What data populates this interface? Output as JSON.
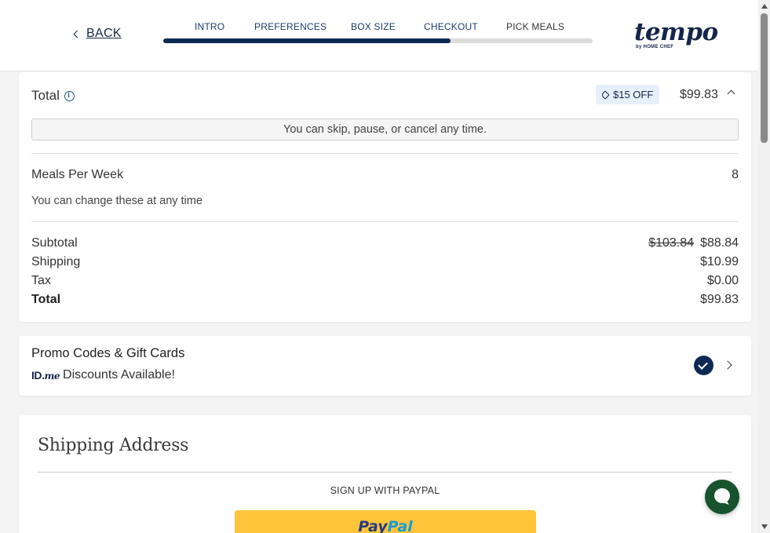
{
  "header": {
    "back_label": "BACK",
    "steps": [
      "INTRO",
      "PREFERENCES",
      "BOX SIZE",
      "CHECKOUT",
      "PICK MEALS"
    ],
    "progress": 0.67,
    "logo": {
      "word": "tempo",
      "tagline": "by HOME CHEF"
    }
  },
  "summary": {
    "total_label": "Total",
    "discount_badge": "$15 OFF",
    "total_amount": "$99.83",
    "skip_note": "You can skip, pause, or cancel any time.",
    "meals_label": "Meals Per Week",
    "meals_value": "8",
    "change_note": "You can change these at any time",
    "subtotal_label": "Subtotal",
    "subtotal_original": "$103.84",
    "subtotal_value": "$88.84",
    "shipping_label": "Shipping",
    "shipping_value": "$10.99",
    "tax_label": "Tax",
    "tax_value": "$0.00",
    "grand_total_label": "Total",
    "grand_total_value": "$99.83"
  },
  "promo": {
    "title": "Promo Codes & Gift Cards",
    "idme_logo_a": "ID",
    "idme_logo_b": ".me",
    "idme_text": "Discounts Available!"
  },
  "shipping": {
    "title": "Shipping Address",
    "paypal_label": "SIGN UP WITH PAYPAL",
    "paypal_a": "Pay",
    "paypal_b": "Pal"
  },
  "colors": {
    "navy": "#0d2a55",
    "badge_bg": "#e5f0fb",
    "paypal_yellow": "#ffc439",
    "chat_green": "#17532c"
  }
}
